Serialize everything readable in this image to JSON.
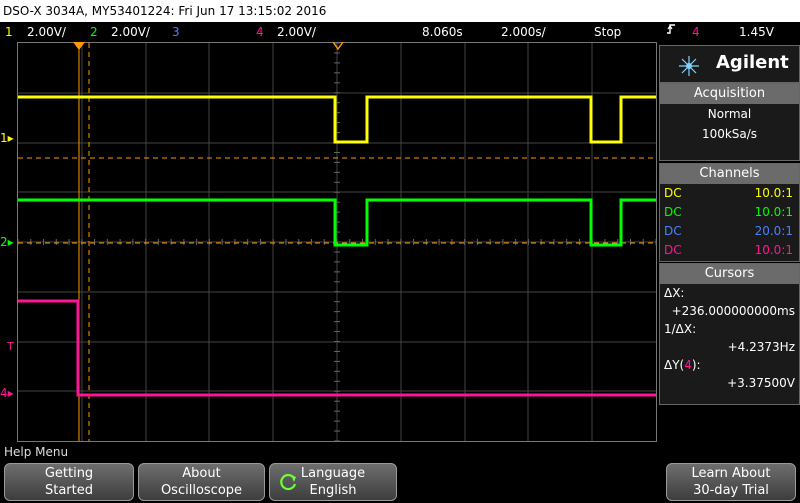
{
  "title": "DSO-X 3034A, MY53401224: Fri Jun 17 13:15:02 2016",
  "status": {
    "ch1_num": "1",
    "ch1_scale": "2.00V/",
    "ch2_num": "2",
    "ch2_scale": "2.00V/",
    "ch3_num": "3",
    "ch4_num": "4",
    "ch4_scale": "2.00V/",
    "time_delay": "8.060s",
    "time_scale": "2.000s/",
    "run_state": "Stop",
    "trigger_icon": "trigger-slope-icon",
    "trigger_source": "4",
    "trigger_level": "1.45V"
  },
  "brand": {
    "name": "Agilent",
    "logo": "agilent-spark-logo"
  },
  "acquisition": {
    "header": "Acquisition",
    "mode": "Normal",
    "rate": "100kSa/s"
  },
  "channels": {
    "header": "Channels",
    "rows": [
      {
        "coupling": "DC",
        "probe": "10.0:1",
        "color": "#ffff00"
      },
      {
        "coupling": "DC",
        "probe": "10.0:1",
        "color": "#00ff00"
      },
      {
        "coupling": "DC",
        "probe": "20.0:1",
        "color": "#4a7fff"
      },
      {
        "coupling": "DC",
        "probe": "10.0:1",
        "color": "#ff1493"
      }
    ]
  },
  "cursors": {
    "header": "Cursors",
    "dx_label": "ΔX:",
    "dx_value": "+236.000000000ms",
    "inv_dx_label": "1/ΔX:",
    "inv_dx_value": "+4.2373Hz",
    "dy_label_prefix": "ΔY(",
    "dy_label_channel": "4",
    "dy_label_suffix": "):",
    "dy_value": "+3.37500V"
  },
  "markers": {
    "ch1": "1",
    "ch2": "2",
    "ch4": "4",
    "trigger": "T"
  },
  "help_menu": {
    "label": "Help Menu"
  },
  "softkeys": [
    {
      "line1": "Getting",
      "line2": "Started"
    },
    {
      "line1": "About",
      "line2": "Oscilloscope"
    },
    {
      "line1": "Language",
      "line2": "English"
    },
    {
      "line1": "Learn About",
      "line2": "30-day Trial"
    }
  ],
  "colors": {
    "ch1": "#ffff00",
    "ch2": "#00ff00",
    "ch3": "#4a7fff",
    "ch4": "#ff1493",
    "cursor": "#ff9900",
    "header_gray": "#6b6b6b"
  }
}
